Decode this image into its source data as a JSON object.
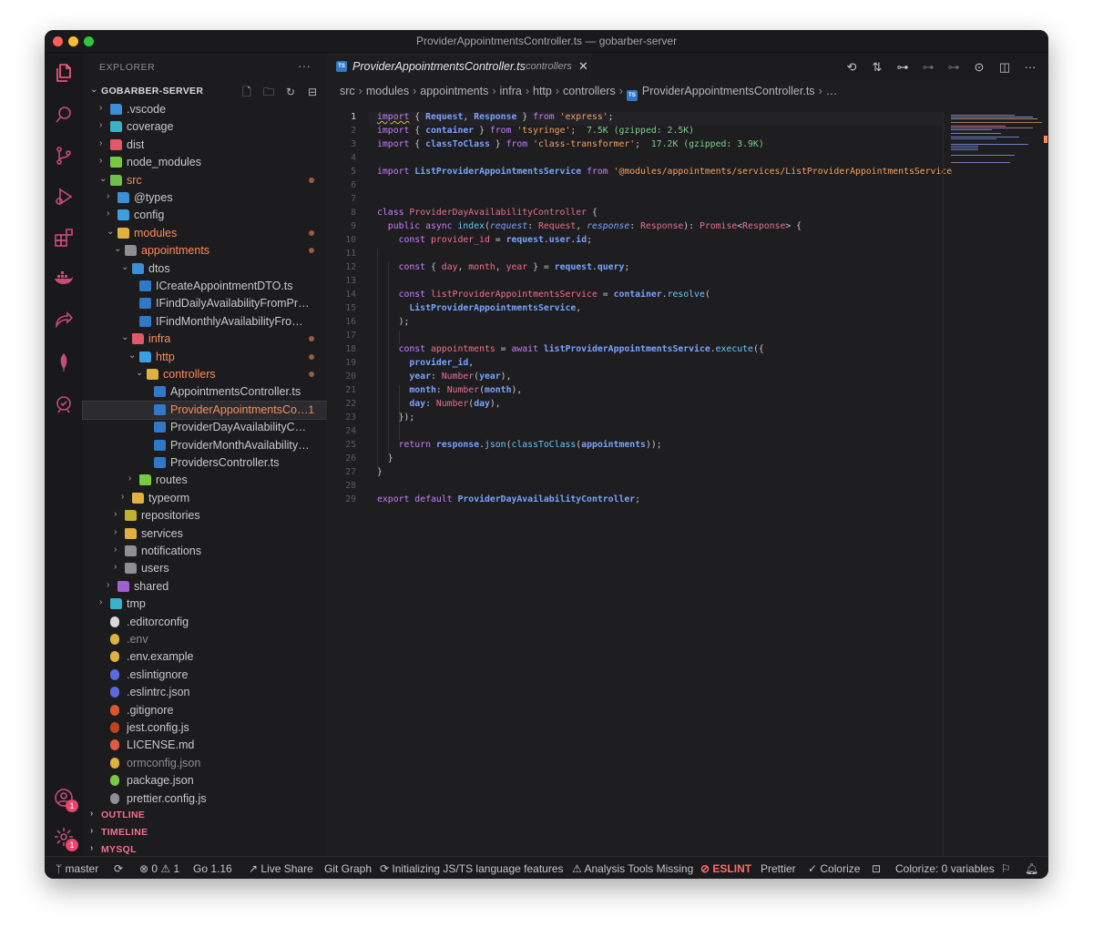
{
  "window": {
    "title": "ProviderAppointmentsController.ts — gobarber-server"
  },
  "activity_bar": {
    "items": [
      {
        "name": "files-icon"
      },
      {
        "name": "search-icon"
      },
      {
        "name": "source-control-icon"
      },
      {
        "name": "run-debug-icon"
      },
      {
        "name": "extensions-icon"
      },
      {
        "name": "docker-icon"
      },
      {
        "name": "live-share-icon"
      },
      {
        "name": "mongo-leaf-icon"
      },
      {
        "name": "test-icon"
      }
    ],
    "account_badge": "1",
    "settings_badge": "1"
  },
  "sidebar": {
    "header": "EXPLORER",
    "more": "···",
    "project": "GOBARBER-SERVER",
    "tree": [
      {
        "label": ".vscode",
        "depth": 0,
        "type": "folder",
        "collapsed": true,
        "icon_color": "#3b8fd6"
      },
      {
        "label": "coverage",
        "depth": 0,
        "type": "folder",
        "collapsed": true,
        "icon_color": "#3bb0c9"
      },
      {
        "label": "dist",
        "depth": 0,
        "type": "folder",
        "collapsed": true,
        "icon_color": "#e05a6a"
      },
      {
        "label": "node_modules",
        "depth": 0,
        "type": "folder",
        "collapsed": true,
        "icon_color": "#7ac943"
      },
      {
        "label": "src",
        "depth": 0,
        "type": "folder",
        "collapsed": false,
        "icon_color": "#6fbf4a",
        "orange": true,
        "modified": true
      },
      {
        "label": "@types",
        "depth": 1,
        "type": "folder",
        "collapsed": true,
        "icon_color": "#3b8fd6"
      },
      {
        "label": "config",
        "depth": 1,
        "type": "folder",
        "collapsed": true,
        "icon_color": "#3b9fe0"
      },
      {
        "label": "modules",
        "depth": 1,
        "type": "folder",
        "collapsed": false,
        "icon_color": "#e0b040",
        "orange": true,
        "modified": true
      },
      {
        "label": "appointments",
        "depth": 2,
        "type": "folder",
        "collapsed": false,
        "icon_color": "#8e8e93",
        "orange": true,
        "modified": true
      },
      {
        "label": "dtos",
        "depth": 3,
        "type": "folder",
        "collapsed": false,
        "icon_color": "#3b8fd6"
      },
      {
        "label": "ICreateAppointmentDTO.ts",
        "depth": 4,
        "type": "ts"
      },
      {
        "label": "IFindDailyAvailabilityFromProvider…",
        "depth": 4,
        "type": "ts"
      },
      {
        "label": "IFindMonthlyAvailabilityFromProvi…",
        "depth": 4,
        "type": "ts"
      },
      {
        "label": "infra",
        "depth": 3,
        "type": "folder",
        "collapsed": false,
        "icon_color": "#e05a6a",
        "orange": true,
        "modified": true
      },
      {
        "label": "http",
        "depth": 4,
        "type": "folder",
        "collapsed": false,
        "icon_color": "#3b9fe0",
        "orange": true,
        "modified": true
      },
      {
        "label": "controllers",
        "depth": 5,
        "type": "folder",
        "collapsed": false,
        "icon_color": "#e0b040",
        "orange": true,
        "modified": true
      },
      {
        "label": "AppointmentsController.ts",
        "depth": 6,
        "type": "ts"
      },
      {
        "label": "ProviderAppointmentsCon…",
        "depth": 6,
        "type": "ts",
        "orange": true,
        "selected": true,
        "badge": "1"
      },
      {
        "label": "ProviderDayAvailabilityControll…",
        "depth": 6,
        "type": "ts"
      },
      {
        "label": "ProviderMonthAvailabilityContr…",
        "depth": 6,
        "type": "ts"
      },
      {
        "label": "ProvidersController.ts",
        "depth": 6,
        "type": "ts"
      },
      {
        "label": "routes",
        "depth": 4,
        "type": "folder",
        "collapsed": true,
        "icon_color": "#7ac943"
      },
      {
        "label": "typeorm",
        "depth": 3,
        "type": "folder",
        "collapsed": true,
        "icon_color": "#e0b040"
      },
      {
        "label": "repositories",
        "depth": 2,
        "type": "folder",
        "collapsed": true,
        "icon_color": "#c0b030"
      },
      {
        "label": "services",
        "depth": 2,
        "type": "folder",
        "collapsed": true,
        "icon_color": "#e0b040"
      },
      {
        "label": "notifications",
        "depth": 2,
        "type": "folder",
        "collapsed": true,
        "icon_color": "#8e8e93"
      },
      {
        "label": "users",
        "depth": 2,
        "type": "folder",
        "collapsed": true,
        "icon_color": "#8e8e93"
      },
      {
        "label": "shared",
        "depth": 1,
        "type": "folder",
        "collapsed": true,
        "icon_color": "#a060d0"
      },
      {
        "label": "tmp",
        "depth": 0,
        "type": "folder",
        "collapsed": true,
        "icon_color": "#3bb0c9"
      },
      {
        "label": ".editorconfig",
        "depth": 0,
        "type": "file",
        "icon_color": "#d8d8dc"
      },
      {
        "label": ".env",
        "depth": 0,
        "type": "file",
        "icon_color": "#e0b040",
        "dim": true
      },
      {
        "label": ".env.example",
        "depth": 0,
        "type": "file",
        "icon_color": "#e0b040"
      },
      {
        "label": ".eslintignore",
        "depth": 0,
        "type": "file",
        "icon_color": "#5a6ae0"
      },
      {
        "label": ".eslintrc.json",
        "depth": 0,
        "type": "file",
        "icon_color": "#5a6ae0"
      },
      {
        "label": ".gitignore",
        "depth": 0,
        "type": "file",
        "icon_color": "#e0552f"
      },
      {
        "label": "jest.config.js",
        "depth": 0,
        "type": "file",
        "icon_color": "#c2421e"
      },
      {
        "label": "LICENSE.md",
        "depth": 0,
        "type": "file",
        "icon_color": "#e05a4a"
      },
      {
        "label": "ormconfig.json",
        "depth": 0,
        "type": "file",
        "icon_color": "#e0b040",
        "dim": true
      },
      {
        "label": "package.json",
        "depth": 0,
        "type": "file",
        "icon_color": "#7ac943"
      },
      {
        "label": "prettier.config.js",
        "depth": 0,
        "type": "file",
        "icon_color": "#8e8e93"
      }
    ],
    "sections": [
      "OUTLINE",
      "TIMELINE",
      "MYSQL"
    ]
  },
  "editor": {
    "tab": {
      "file": "ProviderAppointmentsController.ts",
      "dir": "controllers",
      "close": "✕"
    },
    "breadcrumb": [
      "src",
      "modules",
      "appointments",
      "infra",
      "http",
      "controllers",
      "ProviderAppointmentsController.ts",
      "…"
    ],
    "current_line": 1,
    "line_count": 29
  },
  "status_bar": {
    "branch": "master",
    "problems": "⊗ 0 ⚠ 1",
    "go_version": "Go 1.16",
    "live_share": "Live Share",
    "git_graph": "Git Graph",
    "initializing": "Initializing JS/TS language features",
    "analysis": "Analysis Tools Missing",
    "eslint": "ESLINT",
    "prettier": "Prettier",
    "colorize": "✓ Colorize",
    "colorize_vars": "Colorize: 0 variables"
  },
  "colors": {
    "accent": "#ff5f8a",
    "folder_orange": "#ff8a5c",
    "ts_blue": "#3178c6"
  }
}
